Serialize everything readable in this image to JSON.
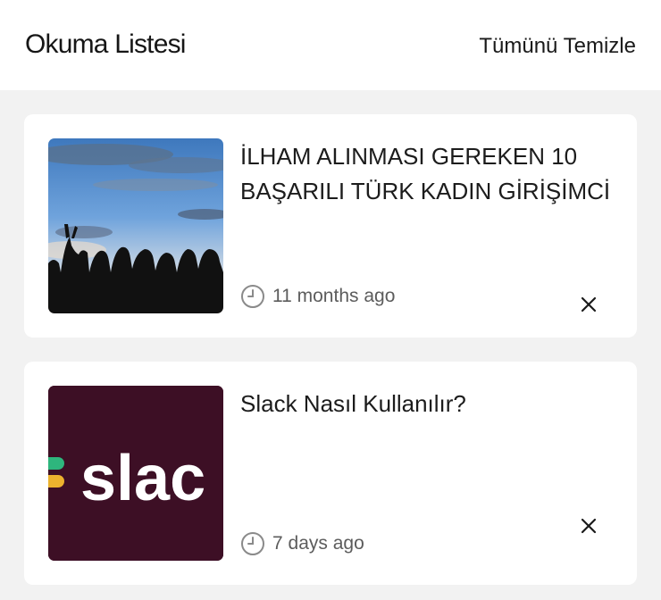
{
  "header": {
    "title": "Okuma Listesi",
    "clear_all_label": "Tümünü Temizle"
  },
  "items": [
    {
      "title": "İLHAM ALINMASI GEREKEN 10 BAŞARILI TÜRK KADIN GİRİŞİMCİ",
      "time_ago": "11 months ago",
      "thumbnail": "silhouettes-sky-image"
    },
    {
      "title": "Slack Nasıl Kullanılır?",
      "time_ago": "7 days ago",
      "thumbnail": "slack-logo-image",
      "thumbnail_text": "slac"
    }
  ],
  "colors": {
    "page_background": "#f2f2f2",
    "card_background": "#ffffff",
    "slack_background": "#3d0f25",
    "sky_blue": "#4a86c8"
  }
}
